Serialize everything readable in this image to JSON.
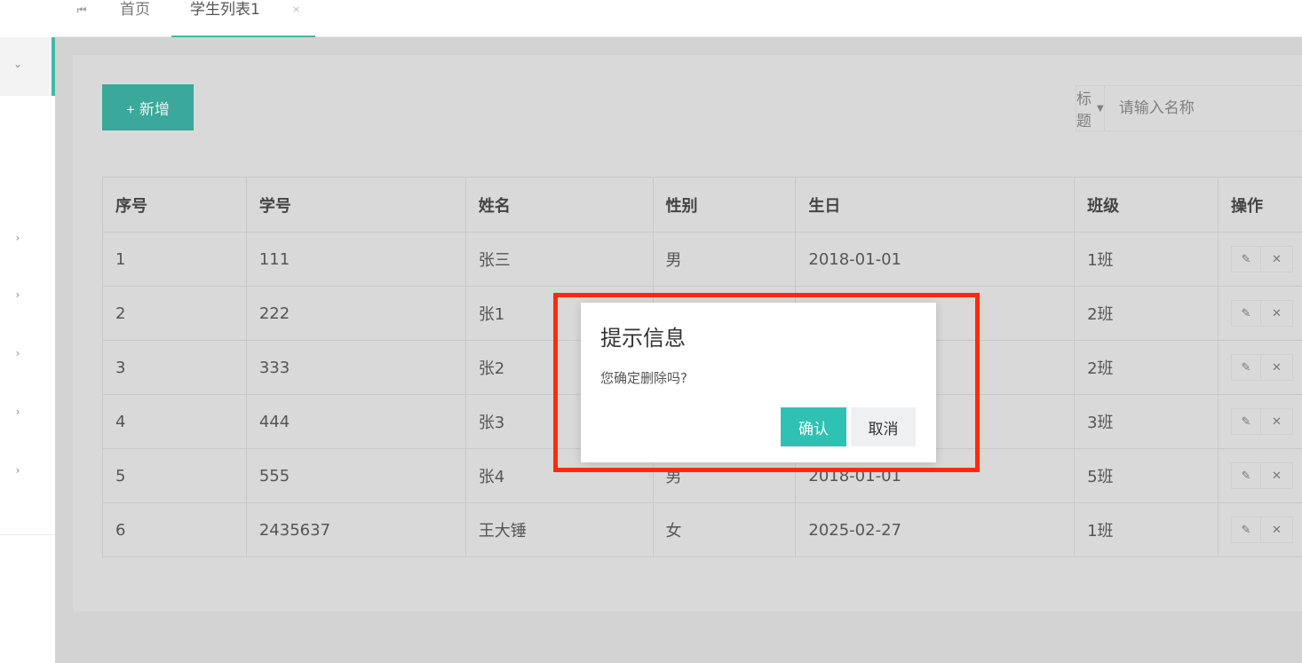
{
  "tabs": {
    "skip_icon": "skip-first-icon",
    "items": [
      {
        "label": "首页"
      },
      {
        "label": "学生列表1"
      }
    ],
    "close_glyph": "×"
  },
  "toolbar": {
    "add_label": "+ 新增",
    "search": {
      "select_label": "标题",
      "placeholder": "请输入名称"
    }
  },
  "table": {
    "headers": [
      "序号",
      "学号",
      "姓名",
      "性别",
      "生日",
      "班级",
      "操作"
    ],
    "rows": [
      [
        "1",
        "111",
        "张三",
        "男",
        "2018-01-01",
        "1班"
      ],
      [
        "2",
        "222",
        "张1",
        "",
        "",
        "2班"
      ],
      [
        "3",
        "333",
        "张2",
        "",
        "",
        "2班"
      ],
      [
        "4",
        "444",
        "张3",
        "",
        "",
        "3班"
      ],
      [
        "5",
        "555",
        "张4",
        "男",
        "2018-01-01",
        "5班"
      ],
      [
        "6",
        "2435637",
        "王大锤",
        "女",
        "2025-02-27",
        "1班"
      ]
    ]
  },
  "dialog": {
    "title": "提示信息",
    "message": "您确定删除吗?",
    "ok_label": "确认",
    "cancel_label": "取消"
  },
  "colors": {
    "accent": "#46b7a8",
    "primary_button": "#3aa89a",
    "dialog_ok": "#2fc2b3",
    "highlight": "#ff2a0f"
  }
}
